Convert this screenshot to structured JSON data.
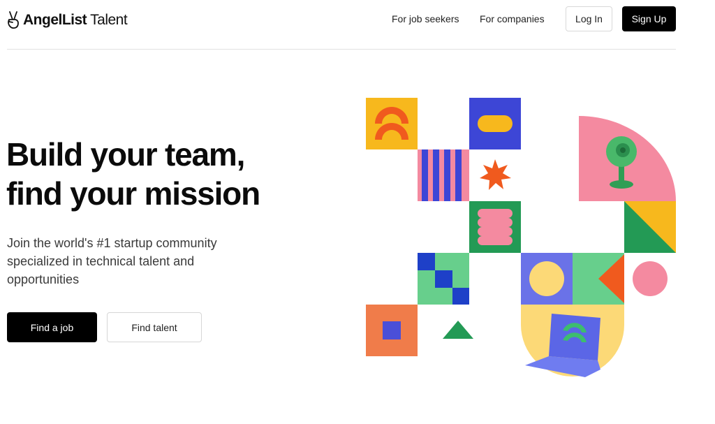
{
  "brand": {
    "name_bold": "AngelList",
    "name_regular": "Talent",
    "icon": "victory-hand-icon"
  },
  "nav": {
    "job_seekers": "For job seekers",
    "companies": "For companies",
    "login": "Log In",
    "signup": "Sign Up"
  },
  "hero": {
    "title_line1": "Build your team,",
    "title_line2": "find your mission",
    "subtitle": "Join the world's #1 startup community specialized in technical talent and opportunities",
    "primary_cta": "Find a job",
    "secondary_cta": "Find talent"
  },
  "colors": {
    "yellow": "#f7b81d",
    "orange": "#f05a1e",
    "blue": "#3d46d6",
    "pink": "#f48aa0",
    "green": "#239a55",
    "mint": "#67cf8c",
    "light_yellow": "#fcd977",
    "coral": "#f07c4a"
  }
}
